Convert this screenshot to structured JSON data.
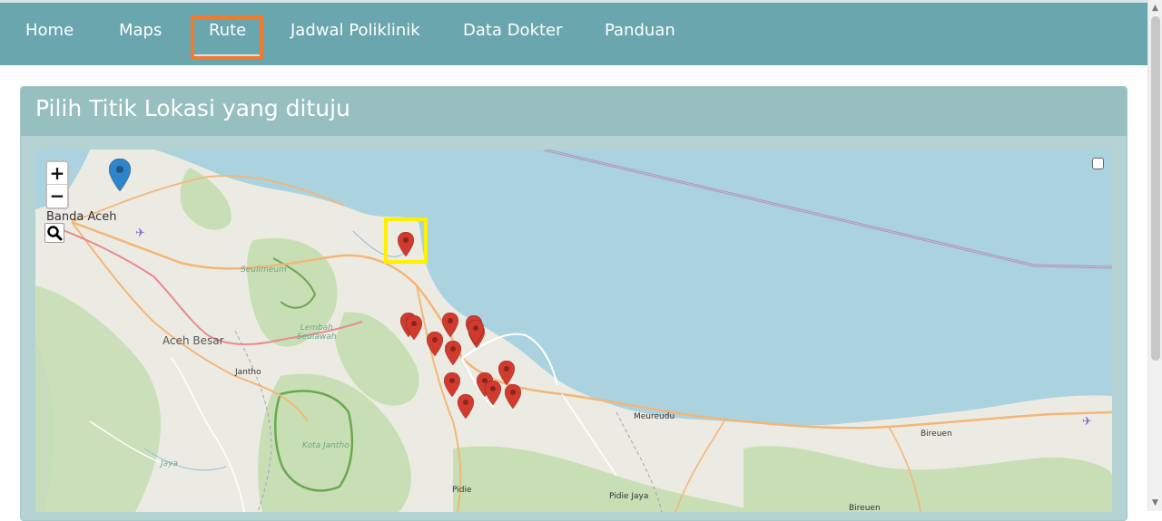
{
  "navbar": {
    "items": [
      "Home",
      "Maps",
      "Rute",
      "Jadwal Poliklinik",
      "Data Dokter",
      "Panduan"
    ],
    "active": "Rute"
  },
  "panel": {
    "title": "Pilih Titik Lokasi yang dituju"
  },
  "map": {
    "zoom_in": "+",
    "zoom_out": "−",
    "labels": {
      "banda_aceh": "Banda Aceh",
      "seulimeum": "Seulimeum",
      "lembah_seulawah": "Lembah\nSeulawah",
      "aceh_besar": "Aceh Besar",
      "jantho": "Jantho",
      "kota_jantho": "Kota Jantho",
      "jaya": "Jaya",
      "pidie": "Pidie",
      "pidie_jaya": "Pidie Jaya",
      "meureudu": "Meureudu",
      "bireuen": "Bireuen",
      "bireuen2": "Bireuen"
    },
    "colors": {
      "sea": "#aad3df",
      "land": "#ecebe3",
      "forest": "#c8dfb5",
      "marker_red": "#d23a2e",
      "marker_blue": "#2e85cb",
      "highlight": "#fff000",
      "nav_active_outline": "#f07a2e"
    },
    "markers": {
      "blue": 1,
      "red": 15
    }
  }
}
